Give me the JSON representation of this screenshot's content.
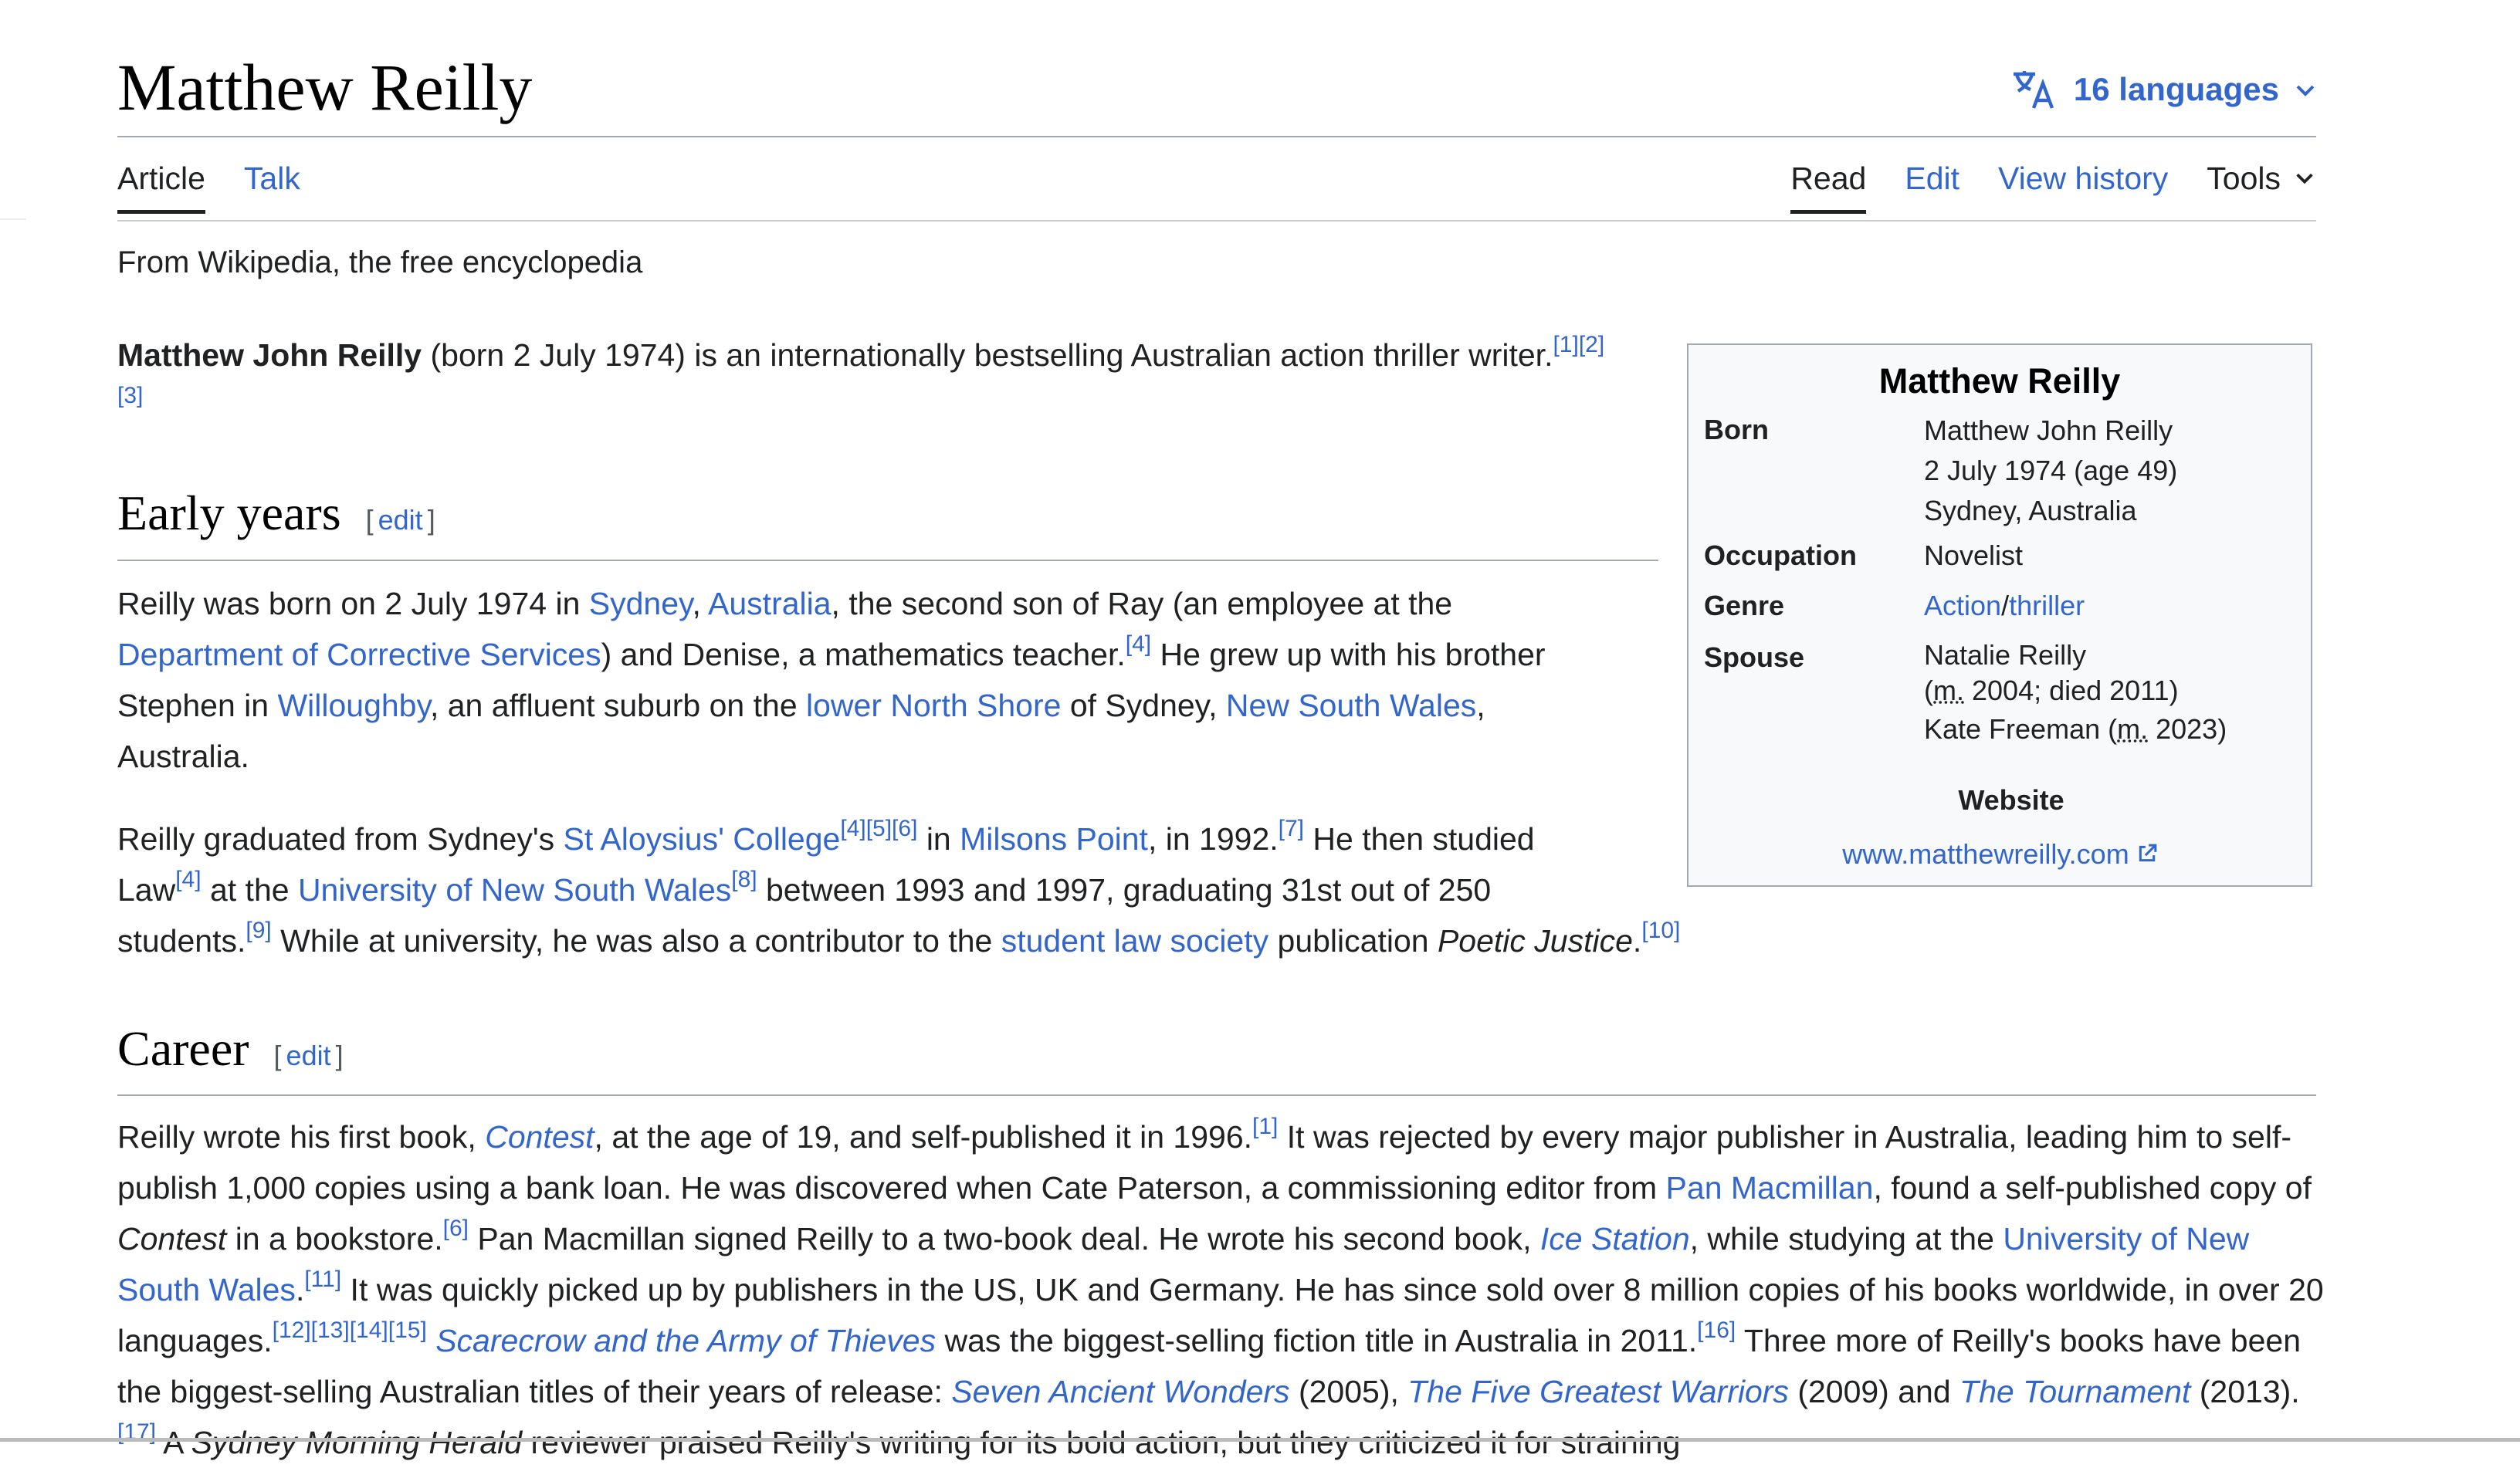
{
  "page": {
    "title": "Matthew Reilly",
    "languages": "16 languages",
    "tabs_left": [
      "Article",
      "Talk"
    ],
    "tabs_right": [
      "Read",
      "Edit",
      "View history",
      "Tools"
    ],
    "tagline": "From Wikipedia, the free encyclopedia",
    "edit_label": "edit"
  },
  "intro": {
    "name": "Matthew John Reilly",
    "text": " (born 2 July 1974) is an internationally bestselling Australian action thriller writer.",
    "refs": "[1][2][3]"
  },
  "early": {
    "heading": "Early years",
    "p1": [
      {
        "t": "Reilly was born on 2 July 1974 in "
      },
      {
        "t": "Sydney",
        "link": true
      },
      {
        "t": ", "
      },
      {
        "t": "Australia",
        "link": true
      },
      {
        "t": ", the second son of Ray (an employee at the "
      },
      {
        "t": "Department of Corrective Services",
        "link": true
      },
      {
        "t": ") and Denise, a mathematics teacher."
      },
      {
        "t": "[4]",
        "sup": true
      },
      {
        "t": " He grew up with his brother Stephen in "
      },
      {
        "t": "Willoughby",
        "link": true
      },
      {
        "t": ", an affluent suburb on the "
      },
      {
        "t": "lower North Shore",
        "link": true
      },
      {
        "t": " of Sydney, "
      },
      {
        "t": "New South Wales",
        "link": true
      },
      {
        "t": ", Australia."
      }
    ],
    "p2_lines": [
      [
        {
          "t": "Reilly graduated from Sydney's "
        },
        {
          "t": "St Aloysius' College",
          "link": true
        },
        {
          "t": "[4][5][6]",
          "sup": true
        },
        {
          "t": " in "
        },
        {
          "t": "Milsons Point",
          "link": true
        },
        {
          "t": ", in 1992."
        },
        {
          "t": "[7]",
          "sup": true
        },
        {
          "t": " He then studied"
        }
      ],
      [
        {
          "t": "Law"
        },
        {
          "t": "[4]",
          "sup": true
        },
        {
          "t": " at the "
        },
        {
          "t": "University of New South Wales",
          "link": true
        },
        {
          "t": "[8]",
          "sup": true
        },
        {
          "t": " between 1993 and 1997, graduating 31st out of 250"
        }
      ],
      [
        {
          "t": "students."
        },
        {
          "t": "[9]",
          "sup": true
        },
        {
          "t": " While at university, he was also a contributor to the "
        },
        {
          "t": "student law society",
          "link": true
        },
        {
          "t": " publication "
        },
        {
          "t": "Poetic Justice",
          "italic": true
        },
        {
          "t": "."
        },
        {
          "t": "[10]",
          "sup": true
        }
      ]
    ]
  },
  "career": {
    "heading": "Career",
    "p": [
      {
        "t": "Reilly wrote his first book, "
      },
      {
        "t": "Contest",
        "link": true,
        "italic": true
      },
      {
        "t": ", at the age of 19, and self-published it in 1996."
      },
      {
        "t": "[1]",
        "sup": true
      },
      {
        "t": " It was rejected by every major publisher in Australia, leading him to self-publish 1,000 copies using a bank loan. He was discovered when Cate Paterson, a commissioning editor from "
      },
      {
        "t": "Pan Macmillan",
        "link": true
      },
      {
        "t": ", found a self-published copy of "
      },
      {
        "t": "Contest",
        "italic": true
      },
      {
        "t": " in a bookstore."
      },
      {
        "t": "[6]",
        "sup": true
      },
      {
        "t": " Pan Macmillan signed Reilly to a two-book deal. He wrote his second book, "
      },
      {
        "t": "Ice Station",
        "link": true,
        "italic": true
      },
      {
        "t": ", while studying at the "
      },
      {
        "t": "University of New South Wales",
        "link": true
      },
      {
        "t": "."
      },
      {
        "t": "[11]",
        "sup": true
      },
      {
        "t": " It was quickly picked up by publishers in the US, UK and Germany. He has since sold over 8 million copies of his books worldwide, in over 20 languages."
      },
      {
        "t": "[12][13][14][15]",
        "sup": true
      },
      {
        "t": " "
      },
      {
        "t": "Scarecrow and the Army of Thieves",
        "link": true,
        "italic": true
      },
      {
        "t": " was the biggest-selling fiction title in Australia in 2011."
      },
      {
        "t": "[16]",
        "sup": true
      },
      {
        "t": " Three more of Reilly's books have been the biggest-selling Australian titles of their years of release: "
      },
      {
        "t": "Seven Ancient Wonders",
        "link": true,
        "italic": true
      },
      {
        "t": " (2005), "
      },
      {
        "t": "The Five Greatest Warriors",
        "link": true,
        "italic": true
      },
      {
        "t": " (2009) and "
      },
      {
        "t": "The Tournament",
        "link": true,
        "italic": true
      },
      {
        "t": " (2013)."
      },
      {
        "t": "[17]",
        "sup": true
      },
      {
        "t": " A "
      },
      {
        "t": "Sydney Morning Herald",
        "italic": true
      },
      {
        "t": " reviewer praised Reilly's writing for its bold action, but they criticized it for straining"
      }
    ]
  },
  "infobox": {
    "title": "Matthew Reilly",
    "born_label": "Born",
    "born": [
      "Matthew John Reilly",
      "2 July 1974 (age 49)",
      "Sydney, Australia"
    ],
    "occupation_label": "Occupation",
    "occupation": "Novelist",
    "genre_label": "Genre",
    "genre_a": "Action",
    "genre_sep": "/",
    "genre_b": "thriller",
    "spouse_label": "Spouse",
    "spouse1": "Natalie Reilly",
    "spouse1_m": "m.",
    "spouse1_detail": " 2004; died 2011)",
    "spouse2": "Kate Freeman (",
    "spouse2_m": "m.",
    "spouse2_detail": " 2023)",
    "website_label": "Website",
    "website": "www.matthewreilly.com"
  },
  "colors": {
    "link": "#3366cc",
    "text": "#202122",
    "rule": "#a2a9b1"
  }
}
